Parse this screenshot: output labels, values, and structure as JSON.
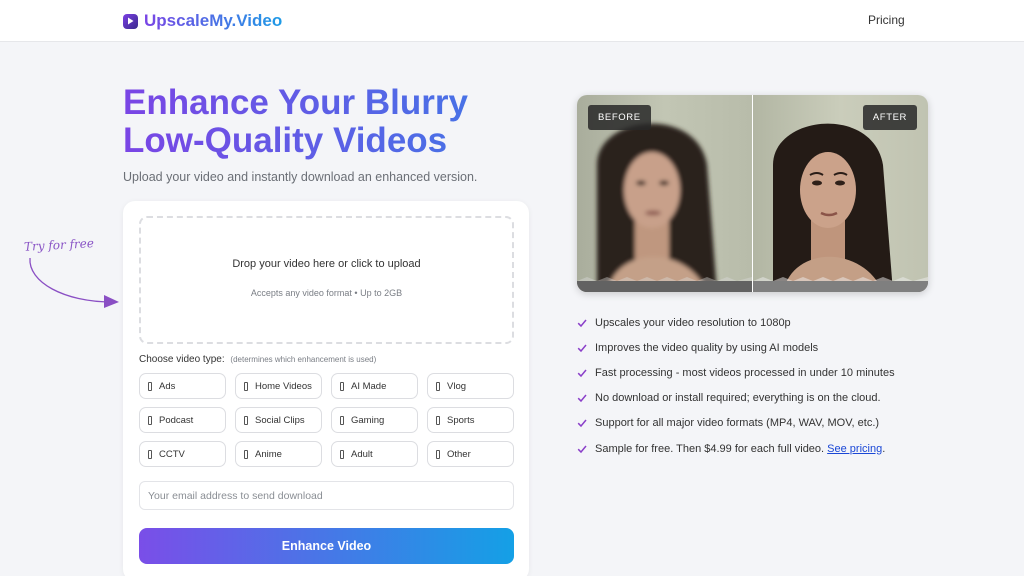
{
  "nav": {
    "logo_text": "UpscaleMy.Video",
    "pricing_label": "Pricing"
  },
  "hero": {
    "title_line1": "Enhance Your Blurry",
    "title_line2": "Low-Quality Videos",
    "subtitle": "Upload your video and instantly download an enhanced version."
  },
  "annotation": {
    "try_free": "Try for free"
  },
  "upload": {
    "dropzone_title": "Drop your video here or click to upload",
    "dropzone_sub": "Accepts any video format • Up to 2GB",
    "video_type_label": "Choose video type:",
    "video_type_hint": "(determines which enhancement is used)",
    "video_types": [
      "Ads",
      "Home Videos",
      "AI Made",
      "Vlog",
      "Podcast",
      "Social Clips",
      "Gaming",
      "Sports",
      "CCTV",
      "Anime",
      "Adult",
      "Other"
    ],
    "email_placeholder": "Your email address to send download",
    "submit_label": "Enhance Video"
  },
  "comparison": {
    "before_label": "BEFORE",
    "after_label": "AFTER"
  },
  "features": [
    "Upscales your video resolution to 1080p",
    "Improves the video quality by using AI models",
    "Fast processing - most videos processed in under 10 minutes",
    "No download or install required; everything is on the cloud.",
    "Support for all major video formats (MP4, WAV, MOV, etc.)"
  ],
  "pricing_feature": {
    "text": "Sample for free. Then $4.99 for each full video. ",
    "link_label": "See pricing",
    "suffix": "."
  },
  "colors": {
    "brand_purple": "#7a45e5",
    "brand_blue": "#1e9be6",
    "check": "#8a3fc9",
    "link": "#1a47d6"
  },
  "icons": {
    "logo": "play-icon",
    "feature_bullet": "check-icon",
    "type_option": "checkbox-icon",
    "annotation": "curved-arrow-icon"
  }
}
